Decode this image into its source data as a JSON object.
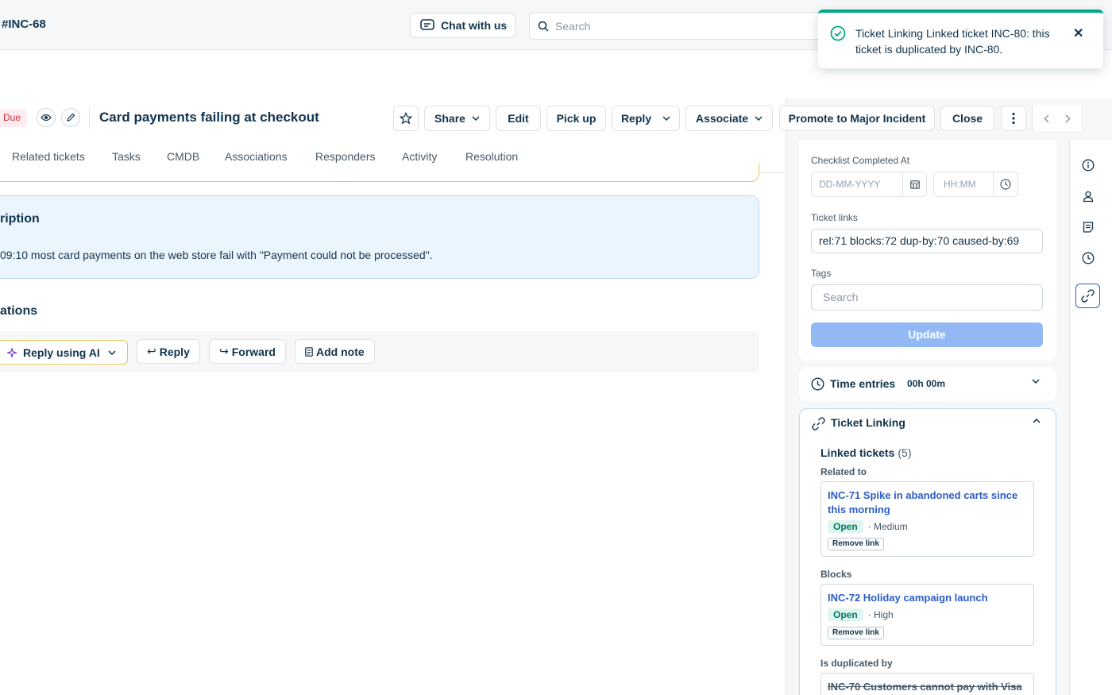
{
  "header": {
    "breadcrumb": "#INC-68",
    "chat_label": "Chat with us",
    "search_placeholder": "Search"
  },
  "toast": {
    "message": "Ticket Linking Linked ticket INC-80: this ticket is duplicated by INC-80.",
    "close": "✕"
  },
  "ticket": {
    "due_badge": "Due",
    "title": "Card payments failing at checkout"
  },
  "toolbar": {
    "share": "Share",
    "edit": "Edit",
    "pick_up": "Pick up",
    "reply": "Reply",
    "associate": "Associate",
    "promote": "Promote to Major Incident",
    "close": "Close"
  },
  "tabs": [
    "Related tickets",
    "Tasks",
    "CMDB",
    "Associations",
    "Responders",
    "Activity",
    "Resolution"
  ],
  "description": {
    "heading": "ription",
    "text": "09:10 most card payments on the web store fail with \"Payment could not be processed\"."
  },
  "conversations": {
    "heading": "ations",
    "reply_ai": "Reply using AI",
    "reply": "Reply",
    "forward": "Forward",
    "add_note": "Add note"
  },
  "properties": {
    "checklist_label": "Checklist Completed At",
    "date_placeholder": "DD-MM-YYYY",
    "time_placeholder": "HH:MM",
    "ticket_links_label": "Ticket links",
    "ticket_links_value": "rel:71 blocks:72 dup-by:70 caused-by:69",
    "tags_label": "Tags",
    "tags_placeholder": "Search",
    "update": "Update"
  },
  "time_entries": {
    "title": "Time entries",
    "value": "00h 00m"
  },
  "ticket_linking": {
    "title": "Ticket Linking",
    "linked_label": "Linked tickets",
    "linked_count": "(5)",
    "groups": [
      {
        "label": "Related to",
        "ticket": "INC-71 Spike in abandoned carts since this morning",
        "status": "Open",
        "priority": "· Medium",
        "remove": "Remove link"
      },
      {
        "label": "Blocks",
        "ticket": "INC-72 Holiday campaign launch",
        "status": "Open",
        "priority": "· High",
        "remove": "Remove link"
      },
      {
        "label": "Is duplicated by",
        "ticket": "INC-70 Customers cannot pay with Visa"
      }
    ]
  },
  "colors": {
    "accent": "#2c5cc5",
    "success": "#00a886",
    "danger": "#d72d30",
    "update_disabled": "#93b9f5"
  }
}
